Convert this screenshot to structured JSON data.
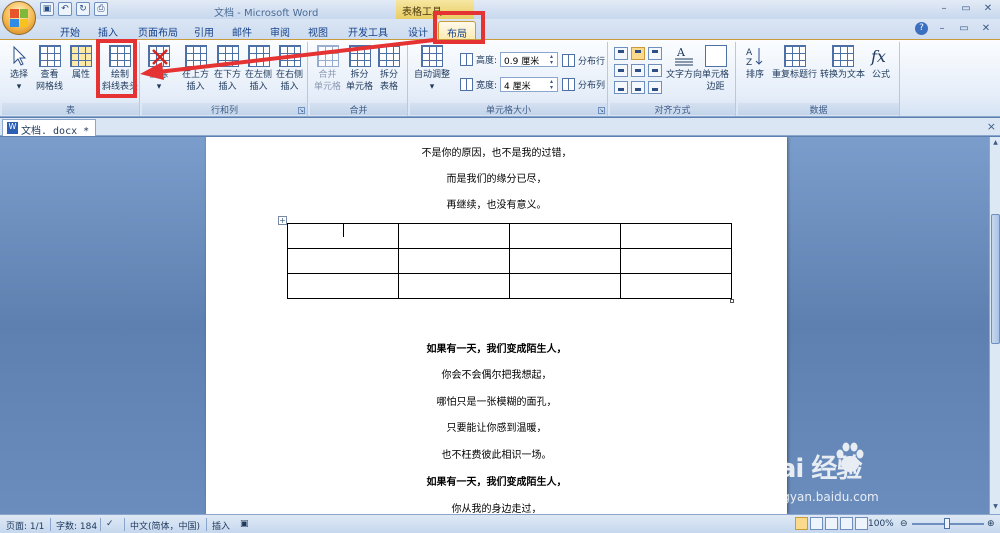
{
  "titlebar": {
    "title": "文档 - Microsoft Word",
    "contextual_label": "表格工具",
    "qat_icons": [
      "save-icon",
      "undo-icon",
      "redo-icon",
      "print-preview-icon"
    ],
    "controls": [
      "–",
      "▭",
      "✕"
    ]
  },
  "tabs": [
    {
      "label": "开始"
    },
    {
      "label": "插入"
    },
    {
      "label": "页面布局"
    },
    {
      "label": "引用"
    },
    {
      "label": "邮件"
    },
    {
      "label": "审阅"
    },
    {
      "label": "视图"
    },
    {
      "label": "开发工具"
    },
    {
      "label": "设计"
    },
    {
      "label": "布局",
      "active": true
    }
  ],
  "ribbon": {
    "groups": {
      "table": "表",
      "rows_cols": "行和列",
      "merge": "合并",
      "cell_size": "单元格大小",
      "alignment": "对齐方式",
      "data": "数据"
    },
    "buttons": {
      "select": "选择",
      "view_grid_1": "查看",
      "view_grid_2": "网格线",
      "properties": "属性",
      "draw_diag_1": "绘制",
      "draw_diag_2": "斜线表头",
      "delete": "删除",
      "ins_above_1": "在上方",
      "ins_above_2": "插入",
      "ins_below_1": "在下方",
      "ins_below_2": "插入",
      "ins_left_1": "在左侧",
      "ins_left_2": "插入",
      "ins_right_1": "在右侧",
      "ins_right_2": "插入",
      "merge_1": "合并",
      "merge_2": "单元格",
      "split_cells_1": "拆分",
      "split_cells_2": "单元格",
      "split_table_1": "拆分",
      "split_table_2": "表格",
      "autofit": "自动调整",
      "height_label": "高度:",
      "height_value": "0.9 厘米",
      "width_label": "宽度:",
      "width_value": "4 厘米",
      "dist_rows": "分布行",
      "dist_cols": "分布列",
      "text_dir_1": "文字方向",
      "cell_margin_1": "单元格",
      "cell_margin_2": "边距",
      "sort": "排序",
      "repeat_header": "重复标题行",
      "convert_text": "转换为文本",
      "formula": "公式"
    }
  },
  "document_tab": {
    "label": "文档. docx *",
    "close": "×"
  },
  "document": {
    "top_lines": [
      "不是你的原因，也不是我的过错，",
      "而是我们的缘分已尽，",
      "再继续，也没有意义。"
    ],
    "table": {
      "rows": 3,
      "cols": 4
    },
    "bottom_lines": [
      {
        "text": "如果有一天，我们变成陌生人，",
        "bold": true
      },
      {
        "text": "你会不会偶尔把我想起，",
        "bold": false
      },
      {
        "text": "哪怕只是一张模糊的面孔，",
        "bold": false
      },
      {
        "text": "只要能让你感到温暖，",
        "bold": false
      },
      {
        "text": "也不枉费彼此相识一场。",
        "bold": false
      },
      {
        "text": "如果有一天，我们变成陌生人，",
        "bold": true
      },
      {
        "text": "你从我的身边走过，",
        "bold": false
      }
    ]
  },
  "statusbar": {
    "page": "页面: 1/1",
    "words": "字数: 184",
    "language": "中文(简体，中国)",
    "mode": "插入",
    "zoom": "100%"
  },
  "watermark": {
    "text": "Bai 经验",
    "url": "jingyan.baidu.com"
  },
  "colors": {
    "highlight": "#e53232",
    "accent": "#15428b"
  }
}
